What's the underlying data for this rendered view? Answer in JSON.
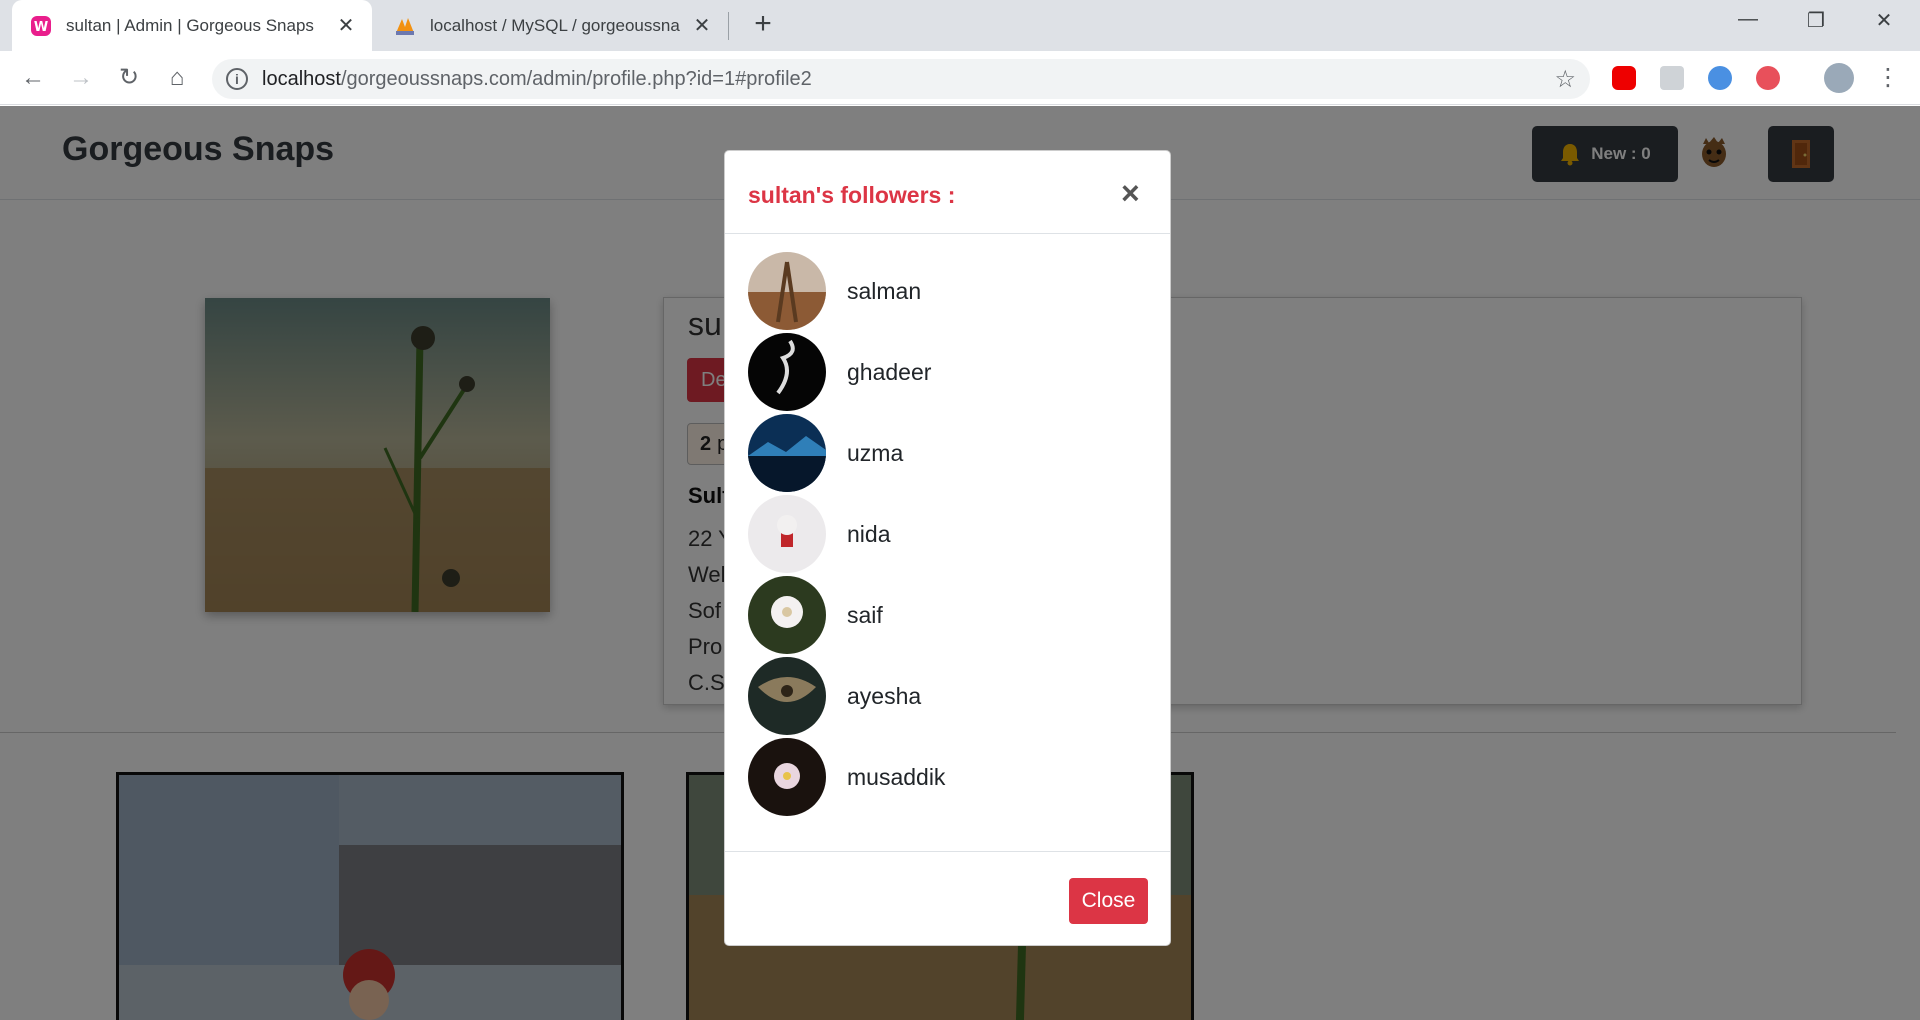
{
  "browser": {
    "tabs": [
      {
        "title": "sultan | Admin | Gorgeous Snaps",
        "close": "✕",
        "icon": "wamp-icon"
      },
      {
        "title": "localhost / MySQL / gorgeoussna",
        "close": "✕",
        "icon": "phpmyadmin-icon"
      }
    ],
    "new_tab": "+",
    "window_controls": {
      "minimize": "—",
      "restore": "❐",
      "close": "✕"
    },
    "url_host": "localhost",
    "url_rest": "/gorgeoussnaps.com/admin/profile.php?id=1#profile2"
  },
  "header": {
    "brand": "Gorgeous Snaps",
    "notifications_label": "New : 0"
  },
  "profile": {
    "username_partial": "su",
    "delete_partial": "De",
    "posts_count": "2",
    "posts_partial": "p",
    "fullname_partial": "Sult",
    "lines": [
      "22 Y",
      "Wel",
      "Sof",
      "Pro",
      "C.S."
    ]
  },
  "modal": {
    "title": "sultan's followers :",
    "close_x": "×",
    "close_button": "Close",
    "followers": [
      {
        "name": "salman"
      },
      {
        "name": "ghadeer"
      },
      {
        "name": "uzma"
      },
      {
        "name": "nida"
      },
      {
        "name": "saif"
      },
      {
        "name": "ayesha"
      },
      {
        "name": "musaddik"
      }
    ]
  },
  "colors": {
    "danger": "#dc3545",
    "dark": "#343a40"
  }
}
